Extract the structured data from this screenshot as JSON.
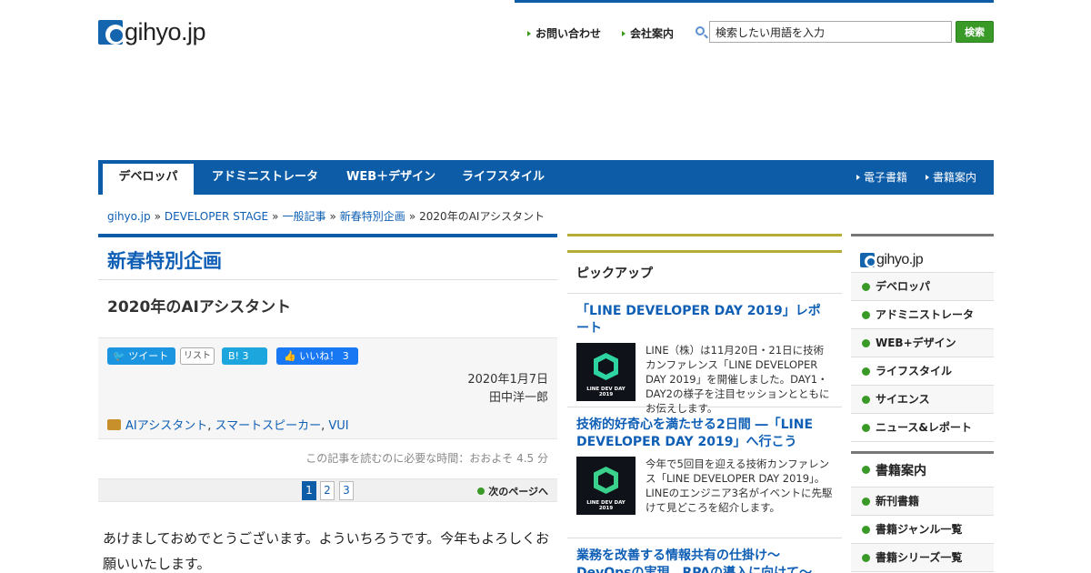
{
  "header": {
    "logo_text": "gihyo.jp",
    "links": [
      "お問い合わせ",
      "会社案内"
    ],
    "search_placeholder": "検索したい用語を入力",
    "search_button": "検索"
  },
  "nav": {
    "tabs": [
      "デベロッパ",
      "アドミニストレータ",
      "WEB＋デザイン",
      "ライフスタイル"
    ],
    "right": [
      "電子書籍",
      "書籍案内"
    ]
  },
  "breadcrumb": [
    "gihyo.jp",
    "DEVELOPER STAGE",
    "一般記事",
    "新春特別企画",
    "2020年のAIアシスタント"
  ],
  "article": {
    "category": "新春特別企画",
    "title": "2020年のAIアシスタント",
    "tweet": "ツイート",
    "list": "リスト",
    "hatena": "B! 3",
    "like": "いいね！ 3",
    "date": "2020年1月7日",
    "author": "田中洋一郎",
    "tags": [
      "AIアシスタント",
      "スマートスピーカー",
      "VUI"
    ],
    "read_time": "この記事を読むのに必要な時間：おおよそ 4.5 分",
    "pages": [
      "1",
      "2",
      "3"
    ],
    "next_page": "次のページへ",
    "body": "あけましておめでとうございます。よういちろうです。今年もよろしくお願いいたします。"
  },
  "pickup": {
    "heading": "ピックアップ",
    "items": [
      {
        "title": "「LINE DEVELOPER DAY 2019」レポート",
        "thumb_label": "LINE DEV DAY 2019",
        "text": "LINE（株）は11月20日・21日に技術カンファレンス「LINE DEVELOPER DAY 2019」を開催しました。DAY1・DAY2の様子を注目セッションとともにお伝えします。"
      },
      {
        "title": "技術的好奇心を満たせる2日間 ―「LINE DEVELOPER DAY 2019」へ行こう",
        "thumb_label": "LINE DEV DAY 2019",
        "text": "今年で5回目を迎える技術カンファレンス「LINE DEVELOPER DAY 2019」。LINEのエンジニア3名がイベントに先駆けて見どころを紹介します。"
      },
      {
        "title": "業務を改善する情報共有の仕掛け～DevOpsの実現、RPAの導入に向けて～"
      }
    ]
  },
  "sidebar": {
    "logo_text": "gihyo.jp",
    "items": [
      "デベロッパ",
      "アドミニストレータ",
      "WEB+デザイン",
      "ライフスタイル",
      "サイエンス",
      "ニュース&レポート"
    ],
    "books_heading": "書籍案内",
    "book_items": [
      "新刊書籍",
      "書籍ジャンル一覧",
      "書籍シリーズ一覧"
    ]
  }
}
